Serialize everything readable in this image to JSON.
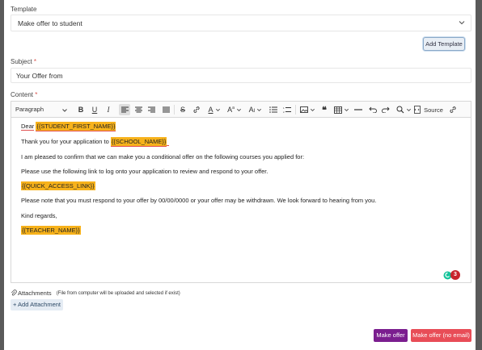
{
  "template": {
    "label": "Template",
    "selected": "Make offer to student",
    "add_button": "Add Template"
  },
  "subject": {
    "label": "Subject",
    "required_mark": "*",
    "value": "Your Offer from"
  },
  "content": {
    "label": "Content",
    "required_mark": "*",
    "toolbar": {
      "paragraph": "Paragraph",
      "source": "Source"
    },
    "body": {
      "dear": "Dear",
      "ph_student_first_name": "{{STUDENT_FIRST_NAME}}",
      "thank_you": "Thank you for your application to",
      "ph_school_name": "{{SCHOOL_NAME}}",
      "line_confirm": "I am pleased to confirm that we can make you a conditional offer on the following courses you applied for:",
      "line_link": "Please use the following link to log onto your application to review and respond to your offer.",
      "ph_quick_access_link": "{{QUICK_ACCESS_LINK}}",
      "line_respond": "Please note that you must respond to your offer by 00/00/0000 or your offer may be withdrawn. We look forward to hearing from you.",
      "kind_regards": "Kind regards,",
      "ph_teacher_name": "{{TEACHER_NAME}}"
    },
    "grammarly_count": "3"
  },
  "attachments": {
    "label": "Attachments",
    "note": "(File from computer will be uploaded and selected if exist)",
    "add_button": "+ Add Attachment"
  },
  "actions": {
    "make_offer": "Make offer",
    "make_offer_no_email": "Make offer (no email)"
  },
  "colors": {
    "placeholder_highlight": "#f7b21b",
    "primary_purple": "#7b1e8f",
    "danger_red": "#e84d57",
    "required": "#d9534f"
  }
}
